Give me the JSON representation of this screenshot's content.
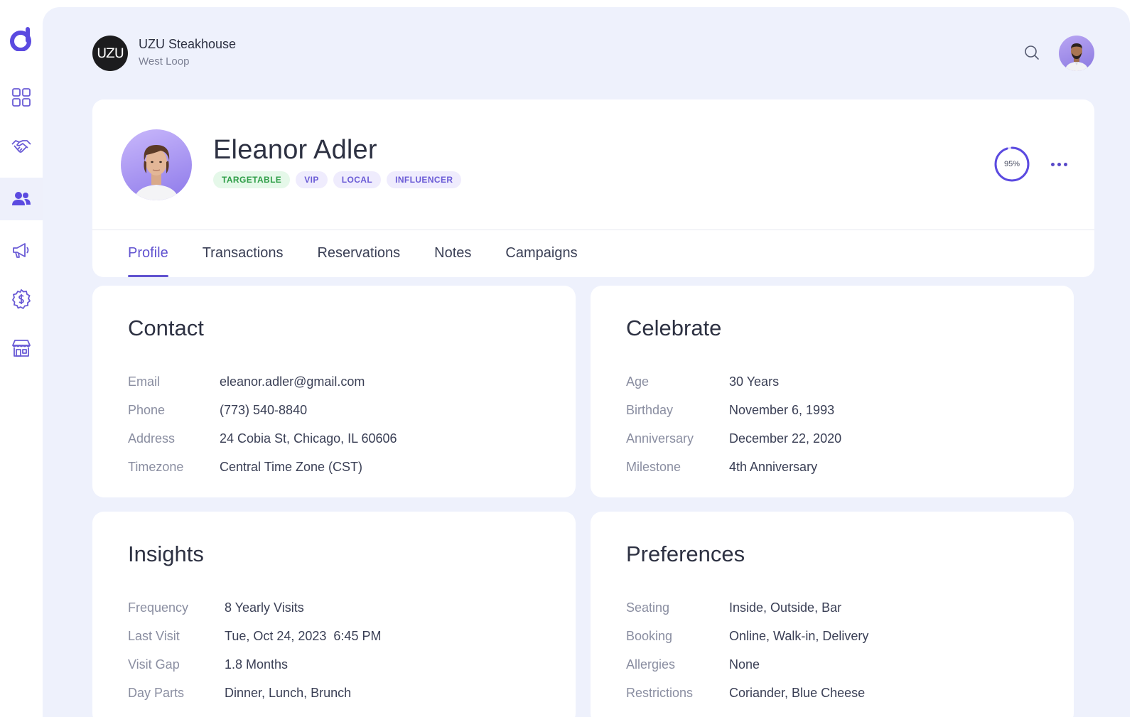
{
  "brand": {
    "initials": "UZU",
    "name": "UZU Steakhouse",
    "location": "West Loop"
  },
  "sidebar": {
    "items": [
      {
        "icon": "grid-icon",
        "active": false
      },
      {
        "icon": "handshake-icon",
        "active": false
      },
      {
        "icon": "users-icon",
        "active": true
      },
      {
        "icon": "megaphone-icon",
        "active": false
      },
      {
        "icon": "dollar-coin-icon",
        "active": false
      },
      {
        "icon": "storefront-icon",
        "active": false
      }
    ]
  },
  "guest": {
    "name": "Eleanor Adler",
    "tags": [
      "TARGETABLE",
      "VIP",
      "LOCAL",
      "INFLUENCER"
    ],
    "score": 0.95,
    "score_label": "95%"
  },
  "tabs": [
    "Profile",
    "Transactions",
    "Reservations",
    "Notes",
    "Campaigns"
  ],
  "active_tab": "Profile",
  "contact": {
    "title": "Contact",
    "rows": [
      {
        "label": "Email",
        "value": "eleanor.adler@gmail.com"
      },
      {
        "label": "Phone",
        "value": "(773) 540-8840"
      },
      {
        "label": "Address",
        "value": "24 Cobia St, Chicago, IL 60606"
      },
      {
        "label": "Timezone",
        "value": "Central Time Zone (CST)"
      }
    ]
  },
  "celebrate": {
    "title": "Celebrate",
    "rows": [
      {
        "label": "Age",
        "value": "30 Years"
      },
      {
        "label": "Birthday",
        "value": "November 6, 1993"
      },
      {
        "label": "Anniversary",
        "value": "December 22, 2020"
      },
      {
        "label": "Milestone",
        "value": "4th Anniversary"
      }
    ]
  },
  "insights": {
    "title": "Insights",
    "rows": [
      {
        "label": "Frequency",
        "value": "8 Yearly Visits"
      },
      {
        "label": "Last Visit",
        "value": "Tue, Oct 24, 2023  6:45 PM"
      },
      {
        "label": "Visit Gap",
        "value": "1.8 Months"
      },
      {
        "label": "Day Parts",
        "value": "Dinner, Lunch, Brunch"
      }
    ]
  },
  "preferences": {
    "title": "Preferences",
    "rows": [
      {
        "label": "Seating",
        "value": "Inside, Outside, Bar"
      },
      {
        "label": "Booking",
        "value": "Online, Walk-in, Delivery"
      },
      {
        "label": "Allergies",
        "value": "None"
      },
      {
        "label": "Restrictions",
        "value": "Coriander, Blue Cheese"
      }
    ]
  },
  "colors": {
    "accent": "#6153d0",
    "canvas": "#eef1fc",
    "tag_green_bg": "#e5f8e9",
    "tag_green_text": "#2f9e48",
    "tag_purple_bg": "#efecfd",
    "tag_purple_text": "#6a5bd6"
  }
}
